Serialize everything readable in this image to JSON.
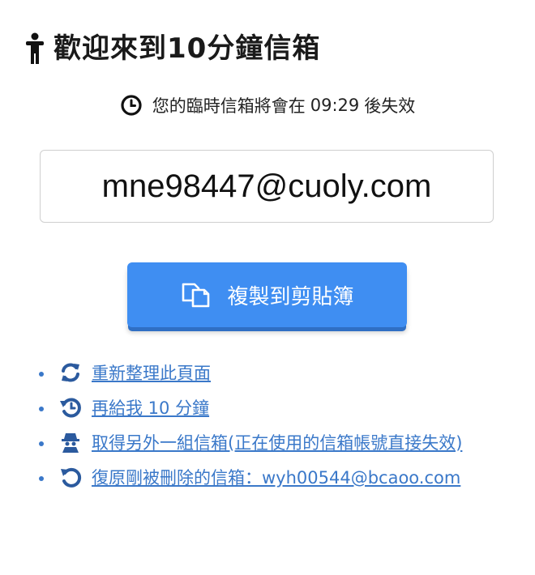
{
  "header": {
    "title": "歡迎來到10分鐘信箱",
    "icon": "person-icon"
  },
  "timer": {
    "prefix": "您的臨時信箱將會在",
    "countdown": "09:29",
    "suffix": "後失效",
    "icon": "clock-icon"
  },
  "email": {
    "address": "mne98447@cuoly.com"
  },
  "copy_button": {
    "label": "複製到剪貼簿",
    "icon": "copy-icon",
    "color": "#3f8ef2"
  },
  "links": [
    {
      "label": "重新整理此頁面",
      "icon": "refresh-icon"
    },
    {
      "label": "再給我 10 分鐘",
      "icon": "history-icon"
    },
    {
      "label": "取得另外一組信箱(正在使用的信箱帳號直接失效)",
      "icon": "spy-icon"
    },
    {
      "label": "復原剛被刪除的信箱：wyh00544@bcaoo.com",
      "icon": "undo-icon"
    }
  ],
  "colors": {
    "link": "#3a78c9",
    "text": "#222222"
  }
}
